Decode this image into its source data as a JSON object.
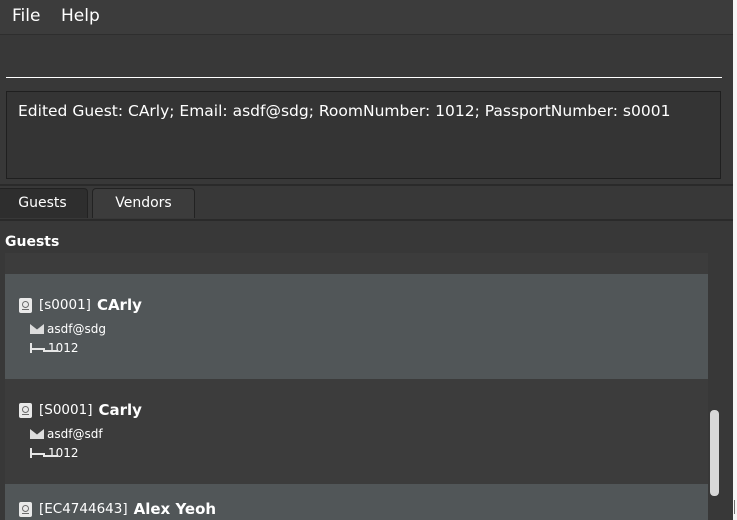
{
  "menu": {
    "file": "File",
    "help": "Help"
  },
  "command_input": {
    "value": ""
  },
  "result": {
    "text": "Edited Guest: CArly; Email: asdf@sdg; RoomNumber: 1012; PassportNumber: s0001"
  },
  "tabs": [
    {
      "label": "Guests"
    },
    {
      "label": "Vendors"
    }
  ],
  "panel": {
    "title": "Guests"
  },
  "guests": [
    {
      "id": "[s0001]",
      "name": "CArly",
      "email": "asdf@sdg",
      "room": "1012"
    },
    {
      "id": "[S0001]",
      "name": "Carly",
      "email": "asdf@sdf",
      "room": "1012"
    },
    {
      "id": "[EC4744643]",
      "name": "Alex Yeoh"
    }
  ],
  "icons": {
    "passport": "passport-icon",
    "email": "mail-icon",
    "room": "bed-icon"
  },
  "colors": {
    "background": "#383838",
    "card_light": "#515658",
    "card_dark": "#3c3c3c",
    "text": "#ffffff"
  }
}
